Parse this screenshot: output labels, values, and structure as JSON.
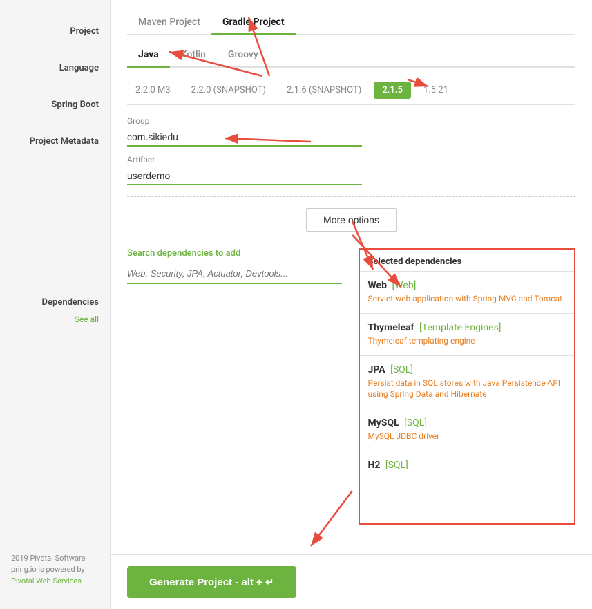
{
  "sidebar": {
    "items": [
      {
        "id": "project",
        "label": "Project"
      },
      {
        "id": "language",
        "label": "Language"
      },
      {
        "id": "spring-boot",
        "label": "Spring Boot"
      },
      {
        "id": "project-metadata",
        "label": "Project Metadata"
      },
      {
        "id": "dependencies",
        "label": "Dependencies"
      }
    ],
    "see_all": "See all",
    "footer": {
      "line1": "2019 Pivotal Software",
      "line2": "pring.io is powered by",
      "link": "Pivotal Web Services"
    }
  },
  "project": {
    "tabs": [
      {
        "id": "maven",
        "label": "Maven Project",
        "active": false
      },
      {
        "id": "gradle",
        "label": "Gradle Project",
        "active": true
      }
    ]
  },
  "language": {
    "tabs": [
      {
        "id": "java",
        "label": "Java",
        "active": true
      },
      {
        "id": "kotlin",
        "label": "Kotlin",
        "active": false
      },
      {
        "id": "groovy",
        "label": "Groovy",
        "active": false
      }
    ]
  },
  "spring_boot": {
    "versions": [
      {
        "id": "2.2.0m3",
        "label": "2.2.0 M3",
        "active": false
      },
      {
        "id": "2.2.0snap",
        "label": "2.2.0 (SNAPSHOT)",
        "active": false
      },
      {
        "id": "2.1.6snap",
        "label": "2.1.6 (SNAPSHOT)",
        "active": false
      },
      {
        "id": "2.1.5",
        "label": "2.1.5",
        "active": true
      },
      {
        "id": "1.5.21",
        "label": "1.5.21",
        "active": false
      }
    ]
  },
  "metadata": {
    "group_label": "Group",
    "group_value": "com.sikiedu",
    "artifact_label": "Artifact",
    "artifact_value": "userdemo"
  },
  "more_options": {
    "label": "More options"
  },
  "dependencies": {
    "search_label": "Search dependencies to add",
    "search_placeholder": "Web, Security, JPA, Actuator, Devtools...",
    "selected_label": "Selected dependencies",
    "items": [
      {
        "name": "Web",
        "category": "[Web]",
        "description": "Servlet web application with Spring MVC and Tomcat"
      },
      {
        "name": "Thymeleaf",
        "category": "[Template Engines]",
        "description": "Thymeleaf templating engine"
      },
      {
        "name": "JPA",
        "category": "[SQL]",
        "description": "Persist data in SQL stores with Java Persistence API using Spring Data and Hibernate"
      },
      {
        "name": "MySQL",
        "category": "[SQL]",
        "description": "MySQL JDBC driver"
      },
      {
        "name": "H2",
        "category": "[SQL]",
        "description": ""
      }
    ]
  },
  "generate": {
    "label": "Generate Project - alt + ↵"
  }
}
